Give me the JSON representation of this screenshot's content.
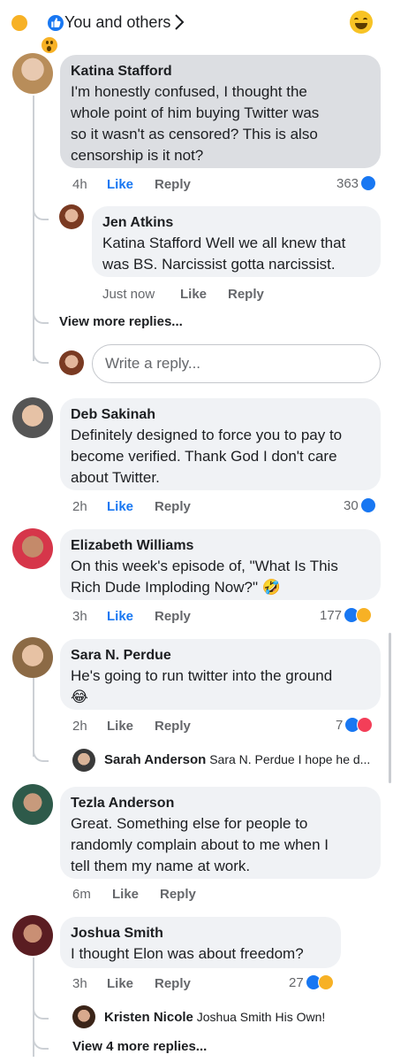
{
  "header": {
    "reactions": [
      "haha",
      "like",
      "wow"
    ],
    "title": "You and others",
    "right_reaction": "haha"
  },
  "comments": [
    {
      "author": "Katina Stafford",
      "text": [
        "I'm honestly confused, I thought the",
        "whole point of him buying Twitter was",
        "so it wasn't as censored? This is also",
        "censorship is it not?"
      ],
      "time": "4h",
      "like": "Like",
      "reply": "Reply",
      "count": "363",
      "reactions": [
        "like"
      ]
    },
    {
      "author": "Jen Atkins",
      "text": [
        "Katina Stafford Well we all knew that",
        "was BS. Narcissist gotta narcissist."
      ],
      "time": "Just now",
      "like": "Like",
      "reply": "Reply"
    },
    {
      "author": "Deb Sakinah",
      "text": [
        "Definitely designed to force you to pay to",
        "become verified. Thank God I don't care",
        "about Twitter."
      ],
      "time": "2h",
      "like": "Like",
      "reply": "Reply",
      "count": "30",
      "reactions": [
        "like"
      ]
    },
    {
      "author": "Elizabeth Williams",
      "text": [
        "On this week's episode of, \"What Is This",
        "Rich Dude Imploding Now?\" 🤣"
      ],
      "time": "3h",
      "like": "Like",
      "reply": "Reply",
      "count": "177",
      "reactions": [
        "like",
        "haha"
      ]
    },
    {
      "author": "Sara N. Perdue",
      "text": [
        "He's going to run twitter into the ground",
        "😂"
      ],
      "time": "2h",
      "like": "Like",
      "reply": "Reply",
      "count": "7",
      "reactions": [
        "like",
        "love"
      ]
    },
    {
      "author": "Tezla Anderson",
      "text": [
        "Great. Something else for people to",
        "randomly complain about to me when I",
        "tell them my name at work."
      ],
      "time": "6m",
      "like": "Like",
      "reply": "Reply"
    },
    {
      "author": "Joshua Smith",
      "text": [
        "I thought Elon was about freedom?"
      ],
      "time": "3h",
      "like": "Like",
      "reply": "Reply",
      "count": "27",
      "reactions": [
        "like",
        "haha"
      ]
    }
  ],
  "view_more_replies_1": "View more replies...",
  "write_reply_placeholder": "Write a reply...",
  "preview_replies": [
    {
      "author": "Sarah Anderson",
      "text": "Sara N. Perdue I hope he d..."
    },
    {
      "author": "Kristen Nicole",
      "text": "Joshua Smith His Own!"
    }
  ],
  "view_more_replies_2": "View 4 more replies...",
  "colors": {
    "accent": "#1877f2",
    "bubble": "#f0f2f5",
    "bubble_selected": "#dcdee2",
    "meta": "#65676b"
  }
}
